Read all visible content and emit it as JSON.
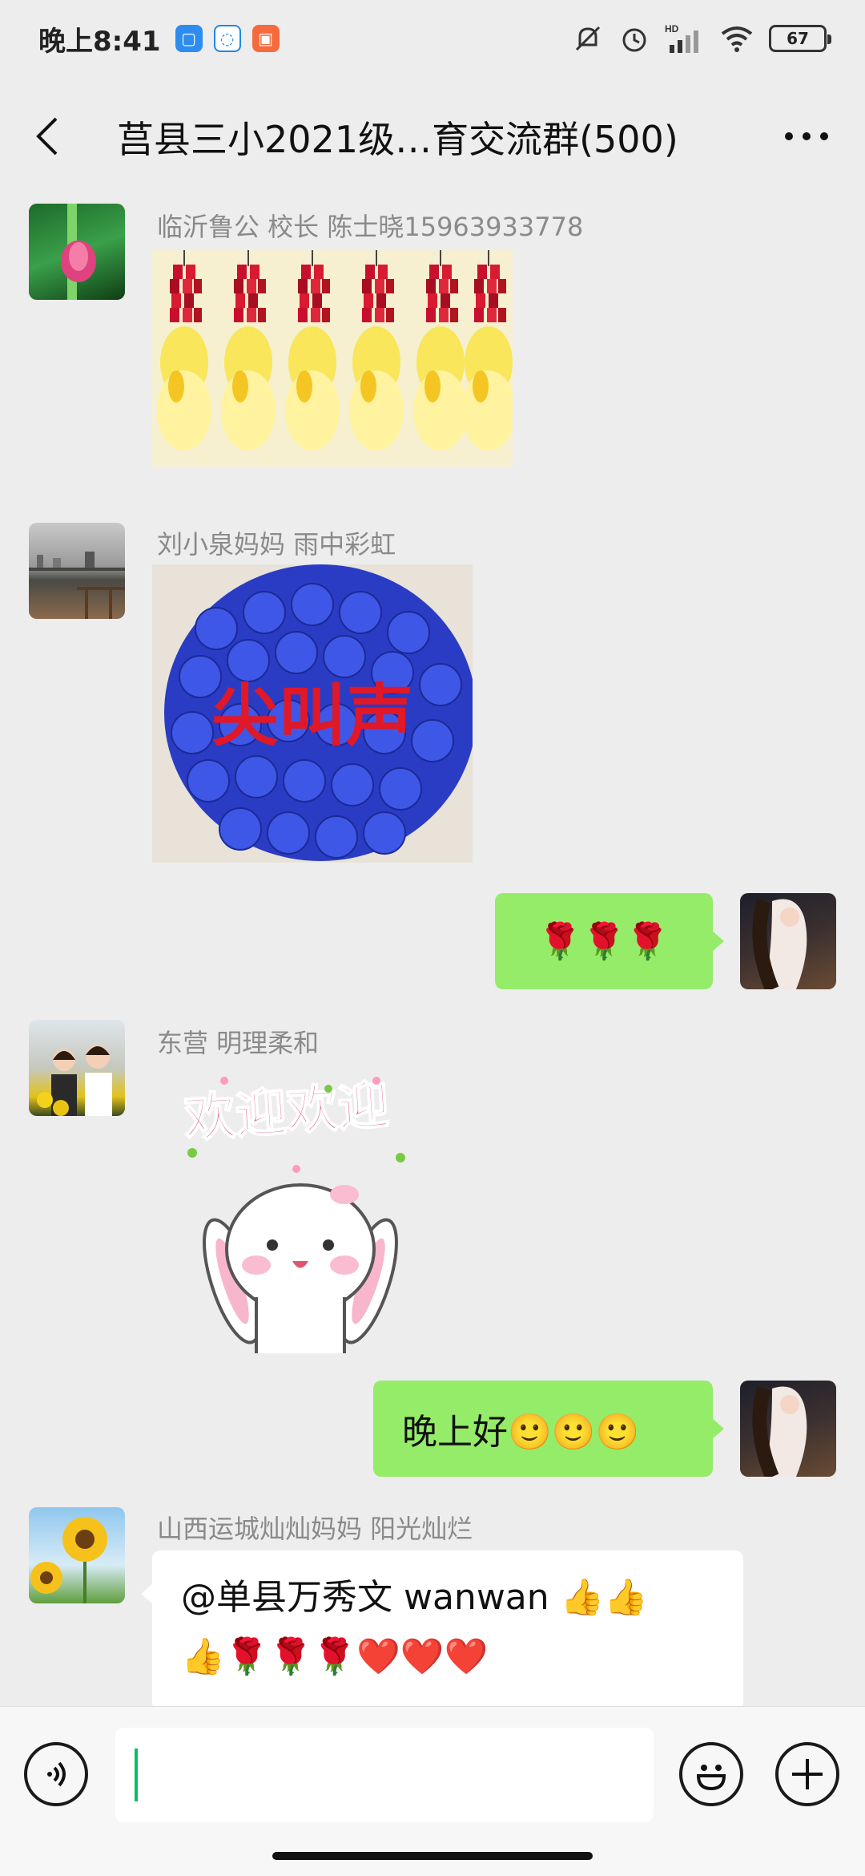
{
  "status_bar": {
    "time": "晚上8:41",
    "battery": "67",
    "network_label": "HD"
  },
  "header": {
    "title": "莒县三小2021级…育交流群(500)"
  },
  "messages": [
    {
      "sender": "临沂鲁公 校长  陈士晓15963933778",
      "type": "image",
      "image_desc": "firecrackers-image"
    },
    {
      "sender": "刘小泉妈妈  雨中彩虹",
      "type": "image",
      "image_caption": "尖叫声"
    },
    {
      "sender": "me",
      "type": "text",
      "text": "🌹🌹🌹"
    },
    {
      "sender": "东营  明理柔和",
      "type": "sticker",
      "sticker_text": "欢迎欢迎"
    },
    {
      "sender": "me",
      "type": "text",
      "text": "晚上好🙂🙂🙂"
    },
    {
      "sender": "山西运城灿灿妈妈  阳光灿烂",
      "type": "text",
      "text_line1": "@单县万秀文  wanwan 👍👍",
      "text_line2": "👍🌹🌹🌹❤️❤️❤️"
    }
  ],
  "input": {
    "placeholder": ""
  },
  "icons": [
    "back-arrow-icon",
    "more-icon",
    "voice-icon",
    "emoji-icon",
    "plus-icon"
  ]
}
